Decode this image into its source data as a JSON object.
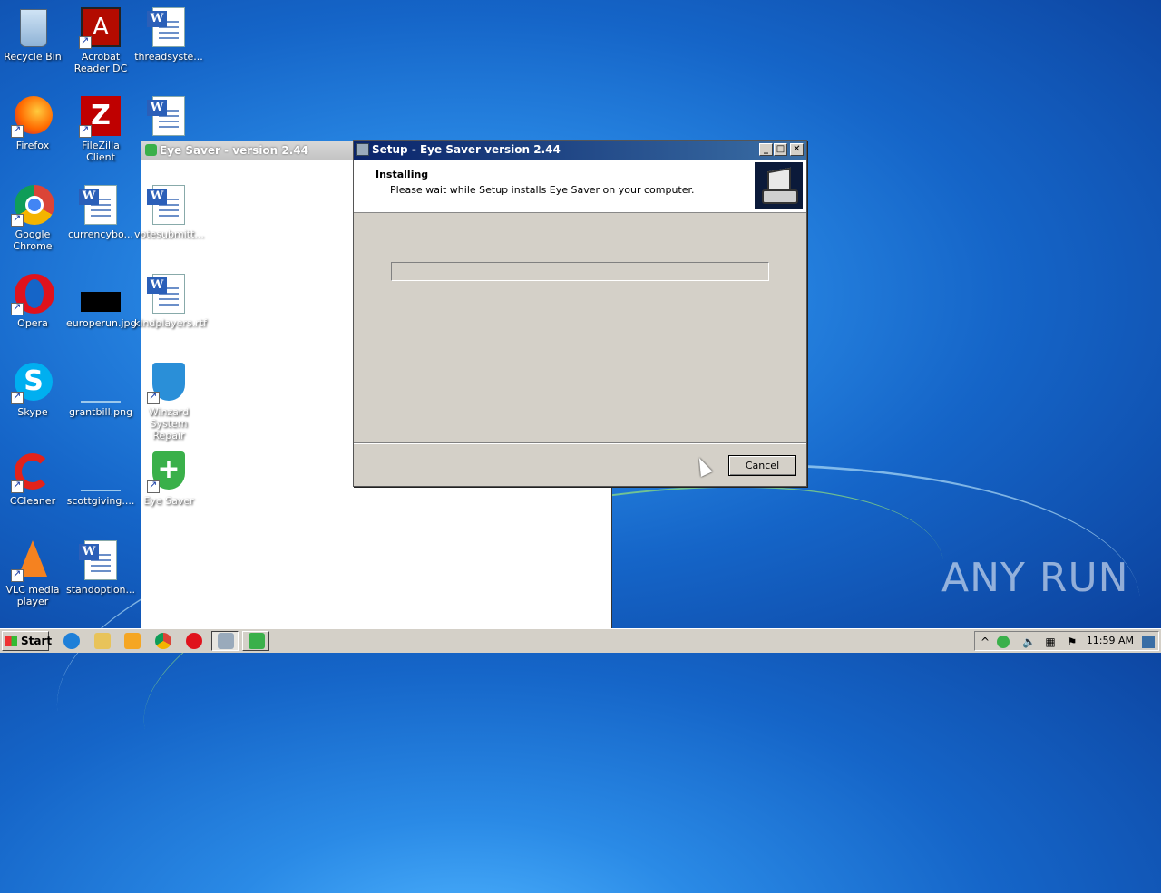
{
  "desktop": {
    "icons": [
      {
        "label": "Recycle Bin"
      },
      {
        "label": "Acrobat Reader DC"
      },
      {
        "label": "threadsyste..."
      },
      {
        "label": "Firefox"
      },
      {
        "label": "FileZilla Client"
      },
      {
        "label": "Google Chrome"
      },
      {
        "label": "currencybo..."
      },
      {
        "label": "votesubmitt..."
      },
      {
        "label": "Opera"
      },
      {
        "label": "europerun.jpg"
      },
      {
        "label": "kindplayers.rtf"
      },
      {
        "label": "Skype"
      },
      {
        "label": "grantbill.png"
      },
      {
        "label": "Winzard System Repair"
      },
      {
        "label": "CCleaner"
      },
      {
        "label": "scottgiving...."
      },
      {
        "label": "Eye Saver"
      },
      {
        "label": "VLC media player"
      },
      {
        "label": "standoption..."
      }
    ]
  },
  "background_window": {
    "title": "Eye Saver - version 2.44"
  },
  "setup_dialog": {
    "title": "Setup - Eye Saver version 2.44",
    "heading": "Installing",
    "subheading": "Please wait while Setup installs Eye Saver on your computer.",
    "progress": 0,
    "cancel_label": "Cancel",
    "minimize": "_",
    "maximize": "□",
    "close": "✕"
  },
  "taskbar": {
    "start_label": "Start",
    "clock": "11:59 AM"
  },
  "watermark": "ANY RUN",
  "colors": {
    "title_bar": "#0a246a",
    "dialog_bg": "#d4d0c8",
    "desktop_blue": "#1565c8"
  }
}
